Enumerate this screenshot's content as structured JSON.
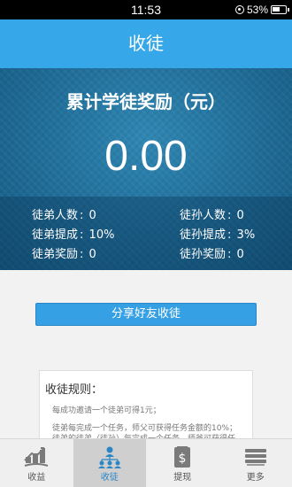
{
  "status_bar": {
    "time": "11:53",
    "battery": "53%"
  },
  "header": {
    "title": "收徒"
  },
  "hero": {
    "title": "累计学徒奖励（元）",
    "amount": "0.00",
    "stats": [
      {
        "label": "徒弟人数",
        "value": "0"
      },
      {
        "label": "徒孙人数",
        "value": "0"
      },
      {
        "label": "徒弟提成",
        "value": "10%"
      },
      {
        "label": "徒孙提成",
        "value": "3%"
      },
      {
        "label": "徒弟奖励",
        "value": "0"
      },
      {
        "label": "徒孙奖励",
        "value": "0"
      }
    ]
  },
  "share_button": {
    "label": "分享好友收徒"
  },
  "rules": {
    "title": "收徒规则：",
    "lines": [
      "每成功邀请一个徒弟可得1元；",
      "徒弟每完成一个任务，师父可获得任务金额的10%；",
      "徒弟的徒弟（徒孙）每完成一个任务，师爷可获得任"
    ]
  },
  "tabs": [
    {
      "label": "收益",
      "icon": "earnings-icon"
    },
    {
      "label": "收徒",
      "icon": "apprentice-icon"
    },
    {
      "label": "提现",
      "icon": "withdraw-icon"
    },
    {
      "label": "更多",
      "icon": "more-icon"
    }
  ]
}
